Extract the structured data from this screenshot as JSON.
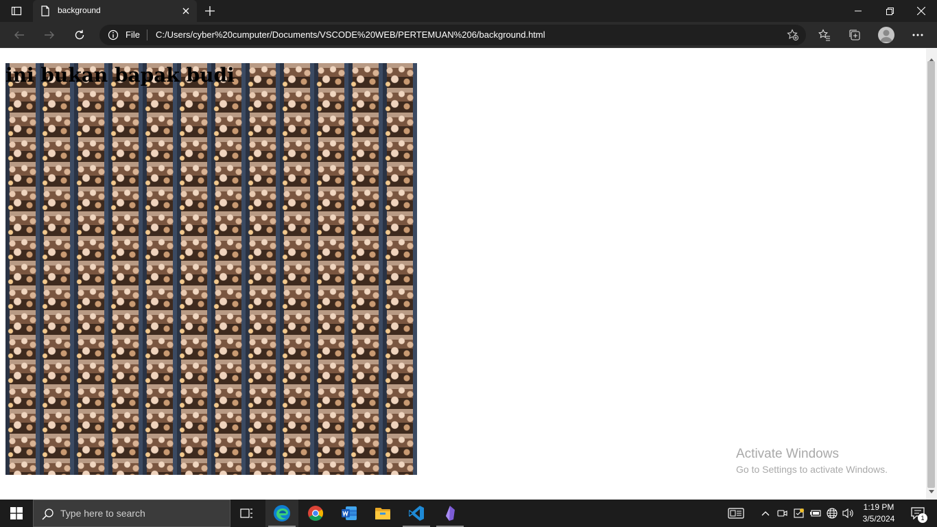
{
  "browser": {
    "tab": {
      "title": "background"
    },
    "address": {
      "scheme_label": "File",
      "url": "C:/Users/cyber%20cumputer/Documents/VSCODE%20WEB/PERTEMUAN%206/background.html"
    }
  },
  "page": {
    "heading": "ini bukan bapak budi"
  },
  "watermark": {
    "line1": "Activate Windows",
    "line2": "Go to Settings to activate Windows."
  },
  "taskbar": {
    "search_placeholder": "Type here to search",
    "apps": [
      "task-view",
      "edge",
      "chrome",
      "word",
      "file-explorer",
      "vscode",
      "obsidian"
    ],
    "time": "1:19 PM",
    "date": "3/5/2024",
    "notification_count": "1"
  },
  "colors": {
    "titlebar": "#1f1f1f",
    "toolbar": "#2b2b2b",
    "taskbar": "#1c1c1c"
  }
}
